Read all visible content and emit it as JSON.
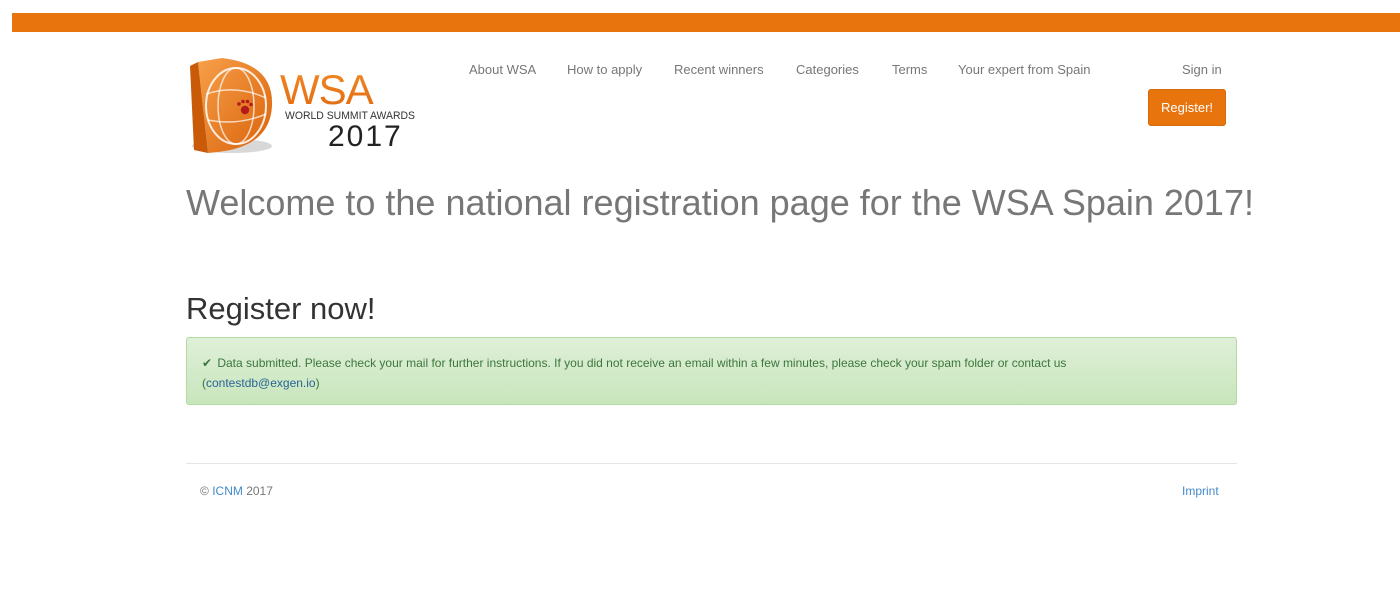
{
  "brand": {
    "logo_main": "WSA",
    "logo_sub": "WORLD SUMMIT AWARDS",
    "logo_year": "2017",
    "accent_color": "#e8740e"
  },
  "nav": {
    "items": [
      {
        "label": "About WSA"
      },
      {
        "label": "How to apply"
      },
      {
        "label": "Recent winners"
      },
      {
        "label": "Categories"
      },
      {
        "label": "Terms"
      },
      {
        "label": "Your expert from Spain"
      }
    ],
    "sign_in": "Sign in",
    "register": "Register!"
  },
  "main": {
    "welcome_title": "Welcome to the national registration page for the WSA Spain 2017!",
    "register_heading": "Register now!",
    "alert": {
      "icon": "check-icon",
      "message": "Data submitted. Please check your mail for further instructions. If you did not receive an email within a few minutes, please check your spam folder or contact us",
      "contact_open": "(",
      "contact_email": "contestdb@exgen.io",
      "contact_close": ")"
    }
  },
  "footer": {
    "copyright_symbol": "©",
    "org_link": "ICNM",
    "year": "2017",
    "imprint": "Imprint"
  }
}
